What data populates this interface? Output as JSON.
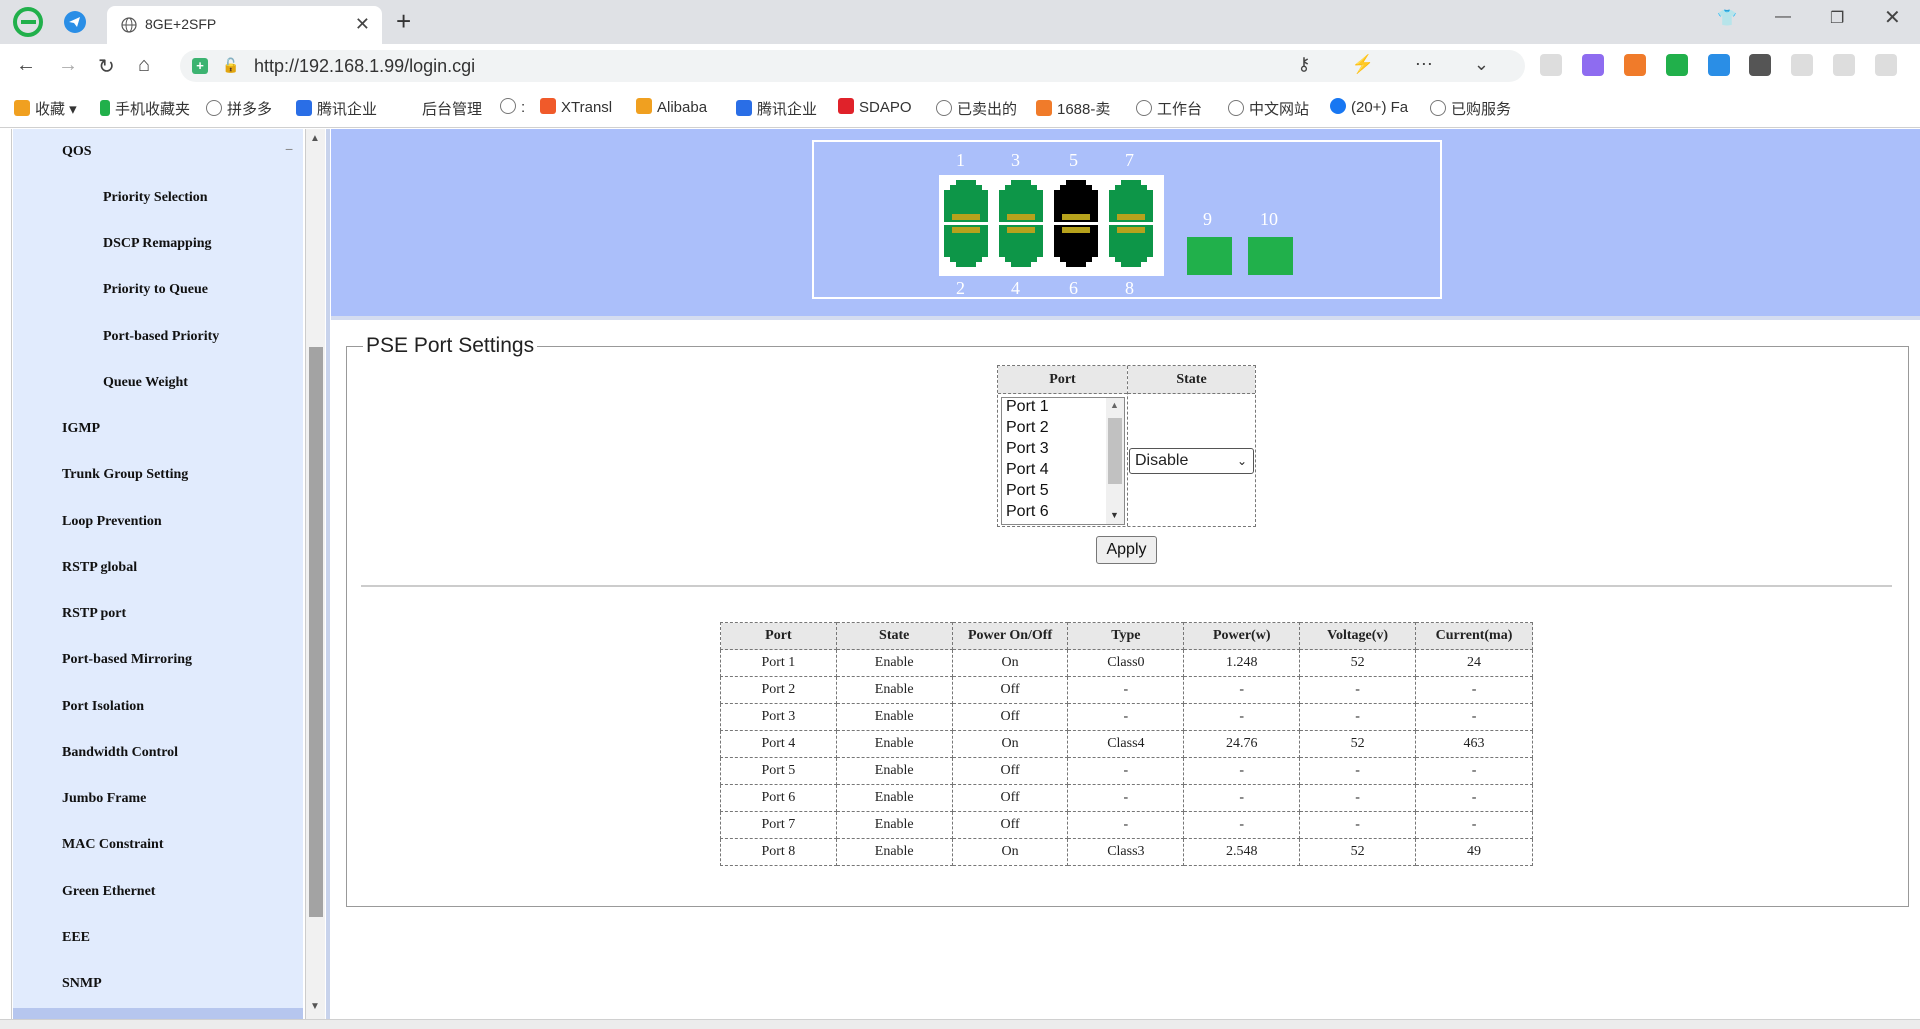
{
  "browser": {
    "tab_title": "8GE+2SFP",
    "url": "http://192.168.1.99/login.cgi",
    "bookmarks": [
      "收藏",
      "手机收藏夹",
      "拼多多",
      "腾讯企业",
      "后台管理",
      ":",
      "XTransl",
      "Alibaba",
      "腾讯企业",
      "SDAPO",
      "已卖出的",
      "1688-卖",
      "工作台",
      "中文网站",
      "(20+) Fa",
      "已购服务"
    ]
  },
  "sidebar": {
    "items": [
      "QOS",
      "Priority Selection",
      "DSCP Remapping",
      "Priority to Queue",
      "Port-based Priority",
      "Queue Weight",
      "IGMP",
      "Trunk Group Setting",
      "Loop Prevention",
      "RSTP global",
      "RSTP port",
      "Port-based Mirroring",
      "Port Isolation",
      "Bandwidth Control",
      "Jumbo Frame",
      "MAC Constraint",
      "Green Ethernet",
      "EEE",
      "SNMP"
    ],
    "collapse_symbol": "−"
  },
  "ports_panel": {
    "top_numbers": [
      "1",
      "3",
      "5",
      "7"
    ],
    "bottom_numbers": [
      "2",
      "4",
      "6",
      "8"
    ],
    "sfp_numbers": [
      "9",
      "10"
    ],
    "colors": {
      "active": "#0d9648",
      "inactive": "#000000",
      "sfp": "#21b04b",
      "led": "#b6a21c"
    }
  },
  "pse": {
    "legend": "PSE Port Settings",
    "port_header": "Port",
    "state_header": "State",
    "port_options": [
      "Port 1",
      "Port 2",
      "Port 3",
      "Port 4",
      "Port 5",
      "Port 6"
    ],
    "state_value": "Disable",
    "apply_label": "Apply"
  },
  "status_table": {
    "headers": [
      "Port",
      "State",
      "Power On/Off",
      "Type",
      "Power(w)",
      "Voltage(v)",
      "Current(ma)"
    ],
    "rows": [
      [
        "Port 1",
        "Enable",
        "On",
        "Class0",
        "1.248",
        "52",
        "24"
      ],
      [
        "Port 2",
        "Enable",
        "Off",
        "-",
        "-",
        "-",
        "-"
      ],
      [
        "Port 3",
        "Enable",
        "Off",
        "-",
        "-",
        "-",
        "-"
      ],
      [
        "Port 4",
        "Enable",
        "On",
        "Class4",
        "24.76",
        "52",
        "463"
      ],
      [
        "Port 5",
        "Enable",
        "Off",
        "-",
        "-",
        "-",
        "-"
      ],
      [
        "Port 6",
        "Enable",
        "Off",
        "-",
        "-",
        "-",
        "-"
      ],
      [
        "Port 7",
        "Enable",
        "Off",
        "-",
        "-",
        "-",
        "-"
      ],
      [
        "Port 8",
        "Enable",
        "On",
        "Class3",
        "2.548",
        "52",
        "49"
      ]
    ]
  }
}
